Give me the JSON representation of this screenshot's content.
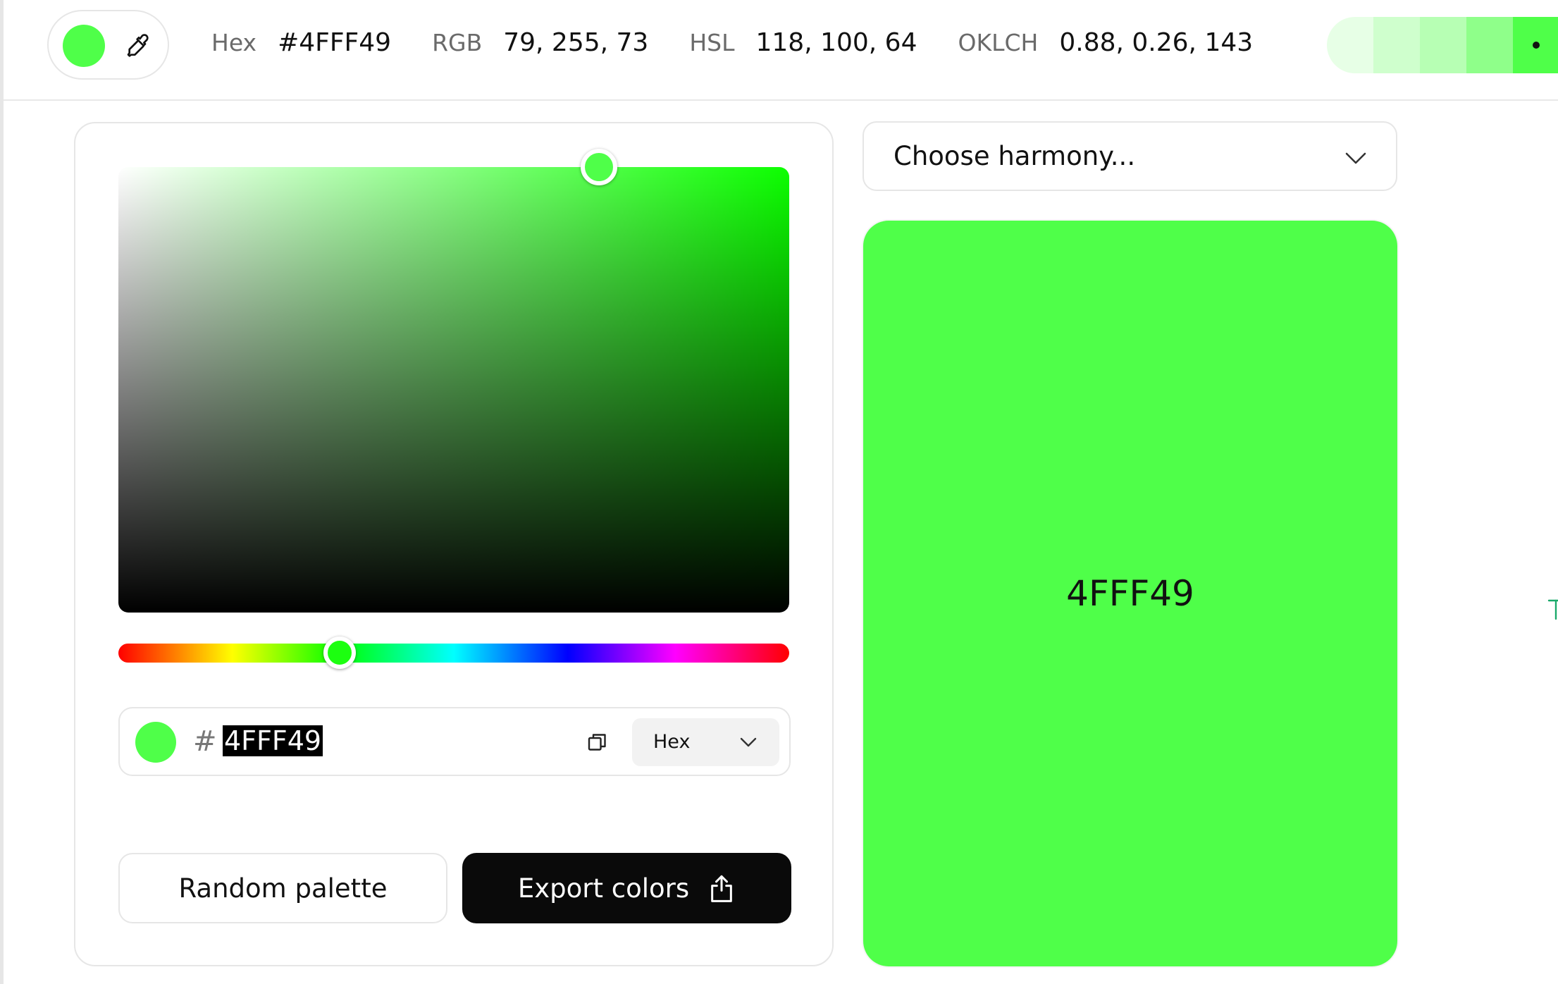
{
  "color": {
    "hex": "#4FFF49",
    "hex_short": "4FFF49",
    "swatch": "#4fff49"
  },
  "topbar": {
    "hex_label": "Hex",
    "hex_value": "#4FFF49",
    "rgb_label": "RGB",
    "rgb_value": "79, 255, 73",
    "hsl_label": "HSL",
    "hsl_value": "118, 100, 64",
    "oklch_label": "OKLCH",
    "oklch_value": "0.88, 0.26, 143",
    "eyedropper_icon": "eyedropper-icon",
    "shade_strip": [
      "#e7ffe6",
      "#cfffcd",
      "#b7ffb4",
      "#8fff8a",
      "#4fff49"
    ],
    "active_shade_index": 4
  },
  "picker": {
    "saturation": 0.71,
    "value": 1.0,
    "hue_position": 0.328,
    "input_hash": "#",
    "input_value": "4FFF49",
    "copy_icon": "copy-icon",
    "format_label": "Hex",
    "format_chevron_icon": "chevron-down-icon"
  },
  "actions": {
    "random_label": "Random palette",
    "export_label": "Export colors",
    "export_icon": "share-icon"
  },
  "harmony": {
    "placeholder": "Choose harmony...",
    "chevron_icon": "chevron-down-icon"
  },
  "preview": {
    "label": "4FFF49",
    "background": "#4fff49"
  }
}
